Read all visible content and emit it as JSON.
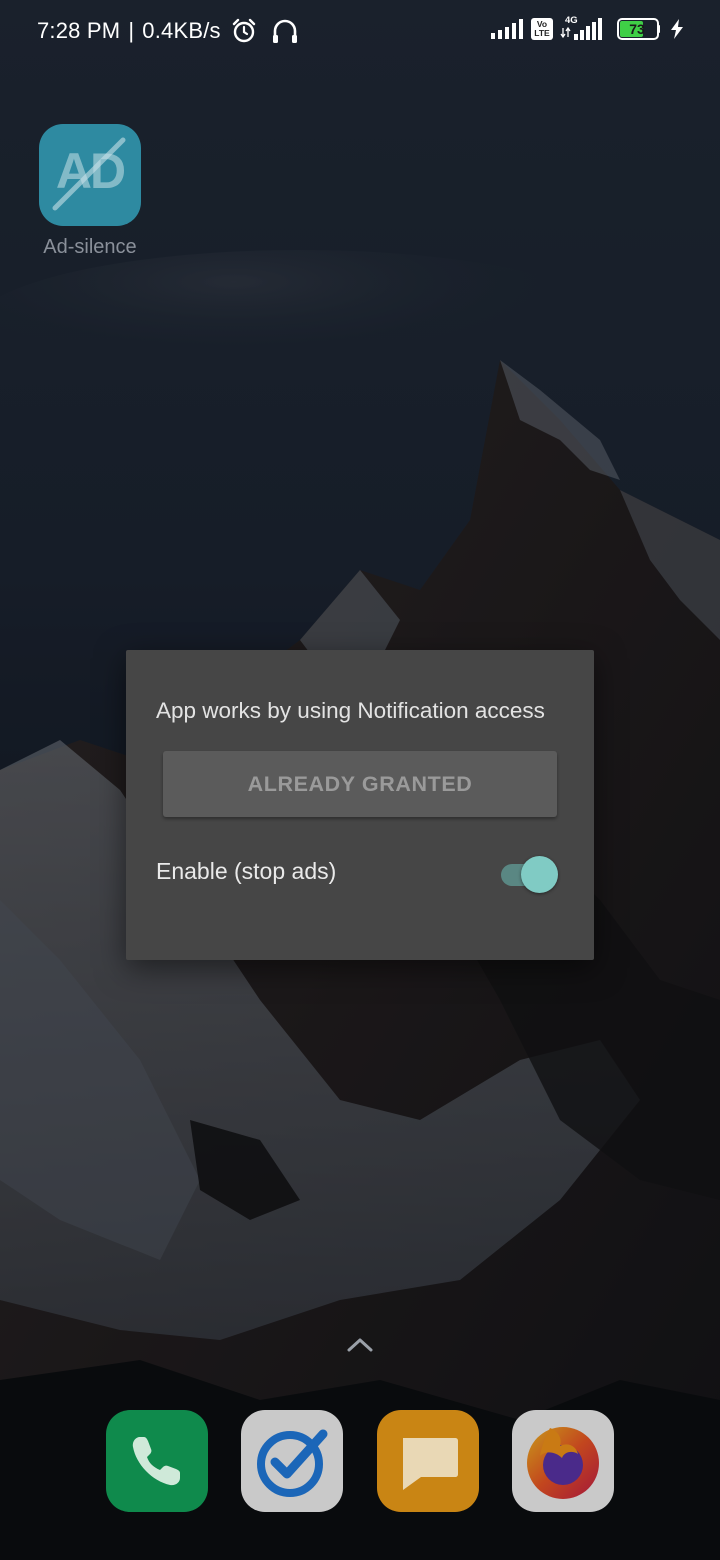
{
  "status_bar": {
    "time": "7:28 PM",
    "separator": "|",
    "network_speed": "0.4KB/s",
    "lte_badge_top": "Vo",
    "lte_badge_bottom": "LTE",
    "network_type": "4G",
    "battery_level": "73",
    "battery_percent": 73,
    "icons": [
      "alarm-icon",
      "headphones-icon",
      "signal-icon",
      "volte-icon",
      "signal-4g-icon",
      "battery-icon",
      "charging-icon"
    ]
  },
  "home": {
    "app_shortcut": {
      "label": "Ad-silence",
      "icon_text": "AD",
      "icon_color": "#2e8aa1"
    },
    "dock": [
      {
        "name": "phone",
        "icon": "phone-icon",
        "color": "#0f8a4c"
      },
      {
        "name": "tasks",
        "icon": "checkmark-icon",
        "color": "#c9c9c9"
      },
      {
        "name": "messages",
        "icon": "message-icon",
        "color": "#c98514"
      },
      {
        "name": "firefox",
        "icon": "firefox-icon",
        "color": "#c9c9c9"
      }
    ]
  },
  "dialog": {
    "message": "App works by using Notification access",
    "granted_button_label": "ALREADY GRANTED",
    "toggle_label": "Enable (stop ads)",
    "toggle_on": true,
    "accent_color": "#80cbc4"
  }
}
